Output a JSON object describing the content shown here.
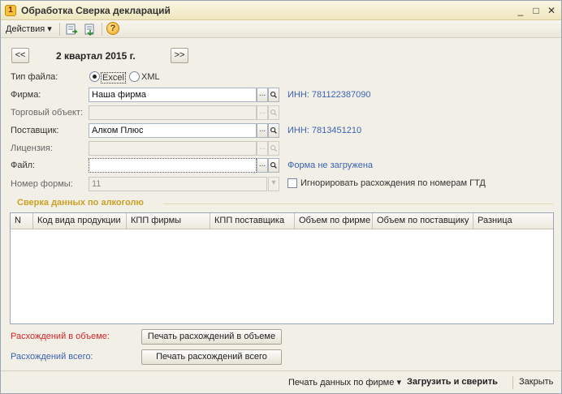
{
  "window": {
    "title": "Обработка  Сверка деклараций",
    "controls": {
      "minimize": "_",
      "maximize": "□",
      "close": "✕"
    }
  },
  "toolbar": {
    "actions_label": "Действия",
    "actions_arrow": "▾",
    "icons": [
      "refresh-icon",
      "export-icon",
      "help-icon"
    ],
    "help_glyph": "?"
  },
  "period": {
    "prev": "<<",
    "label": "2 квартал 2015 г.",
    "next": ">>"
  },
  "form": {
    "file_type_label": "Тип файла:",
    "file_type_options": [
      "Excel",
      "XML"
    ],
    "file_type_selected": "Excel",
    "firm_label": "Фирма:",
    "firm_value": "Наша фирма",
    "firm_inn": "ИНН: 781122387090",
    "trade_object_label": "Торговый объект:",
    "trade_object_value": "",
    "supplier_label": "Поставщик:",
    "supplier_value": "Алком Плюс",
    "supplier_inn": "ИНН: 7813451210",
    "license_label": "Лицензия:",
    "license_value": "",
    "file_label": "Файл:",
    "file_value": "",
    "file_status": "Форма не загружена",
    "form_number_label": "Номер формы:",
    "form_number_value": "11",
    "ignore_gtd_label": "Игнорировать расхождения по номерам ГТД",
    "ignore_gtd_checked": false,
    "select_glyph": "...",
    "search_glyph": "🔍",
    "dropdown_glyph": "▾"
  },
  "section": {
    "title": "Сверка данных по алкоголю"
  },
  "table": {
    "columns": [
      "N",
      "Код вида продукции",
      "КПП фирмы",
      "КПП поставщика",
      "Объем по фирме",
      "Объем по поставщику",
      "Разница"
    ],
    "rows": []
  },
  "summary": {
    "volume_diff_label": "Расхождений в объеме:",
    "volume_diff_button": "Печать расхождений в объеме",
    "total_diff_label": "Расхождений всего:",
    "total_diff_button": "Печать расхождений всего"
  },
  "footer": {
    "print_firm": "Печать данных по фирме",
    "print_firm_arrow": "▾",
    "load_compare": "Загрузить и сверить",
    "close": "Закрыть"
  },
  "colors": {
    "title_bar": "#efe6bf",
    "section_title": "#c9a227",
    "link": "#3b63b3",
    "alert_red": "#d8262b"
  }
}
